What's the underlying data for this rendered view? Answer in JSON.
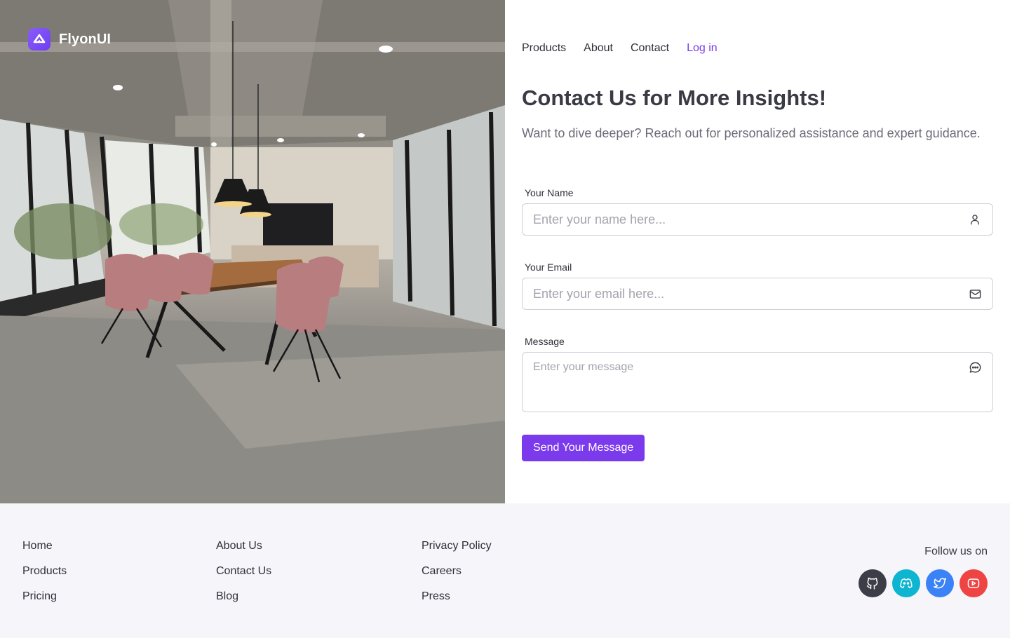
{
  "brand": {
    "name": "FlyonUI",
    "logo_icon": "flyonui-logo-icon",
    "accent": "#7c3aed"
  },
  "nav": {
    "items": [
      {
        "label": "Products"
      },
      {
        "label": "About"
      },
      {
        "label": "Contact"
      }
    ],
    "login_label": "Log in"
  },
  "contact": {
    "title": "Contact Us for More Insights!",
    "subtitle": "Want to dive deeper? Reach out for personalized assistance and expert guidance.",
    "name": {
      "label": "Your Name",
      "placeholder": "Enter your name here...",
      "icon": "user-icon"
    },
    "email": {
      "label": "Your Email",
      "placeholder": "Enter your email here...",
      "icon": "mail-icon"
    },
    "message": {
      "label": "Message",
      "placeholder": "Enter your message",
      "icon": "message-icon"
    },
    "submit_label": "Send Your Message"
  },
  "footer": {
    "col1": [
      "Home",
      "Products",
      "Pricing"
    ],
    "col2": [
      "About Us",
      "Contact Us",
      "Blog"
    ],
    "col3": [
      "Privacy Policy",
      "Careers",
      "Press"
    ],
    "follow_label": "Follow us on",
    "socials": [
      {
        "icon": "github-icon",
        "color": "#3d3d47"
      },
      {
        "icon": "discord-icon",
        "color": "#0eb5d0"
      },
      {
        "icon": "twitter-icon",
        "color": "#3b82f6"
      },
      {
        "icon": "youtube-icon",
        "color": "#ef4444"
      }
    ]
  }
}
